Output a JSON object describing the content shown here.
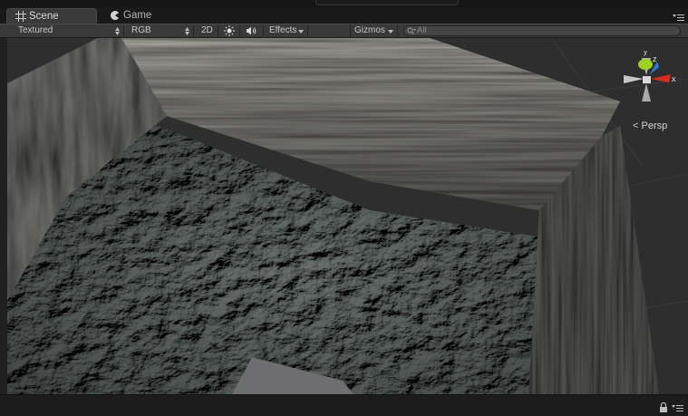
{
  "tabs": [
    {
      "label": "Scene",
      "icon": "scene-grid-icon",
      "active": true
    },
    {
      "label": "Game",
      "icon": "game-pacman-icon",
      "active": false
    }
  ],
  "toolbar": {
    "draw_mode": "Textured",
    "render_mode": "RGB",
    "toggle_2d": "2D",
    "lighting_icon": "sun-icon",
    "audio_icon": "speaker-icon",
    "effects_label": "Effects",
    "gizmos_label": "Gizmos",
    "search_placeholder": "All"
  },
  "viewport": {
    "projection_label": "Persp",
    "gizmo_axes": {
      "y": "y",
      "z": "z",
      "x": "x"
    },
    "colors": {
      "axis_x": "#e02a1a",
      "axis_y": "#9ed21c",
      "axis_z": "#2a7ce0",
      "floor": "#7b827f",
      "wood": "#4b4843",
      "background": "#2e2e2e"
    }
  },
  "status": {
    "lock_icon": "lock-icon",
    "menu_icon": "panel-menu-icon"
  }
}
